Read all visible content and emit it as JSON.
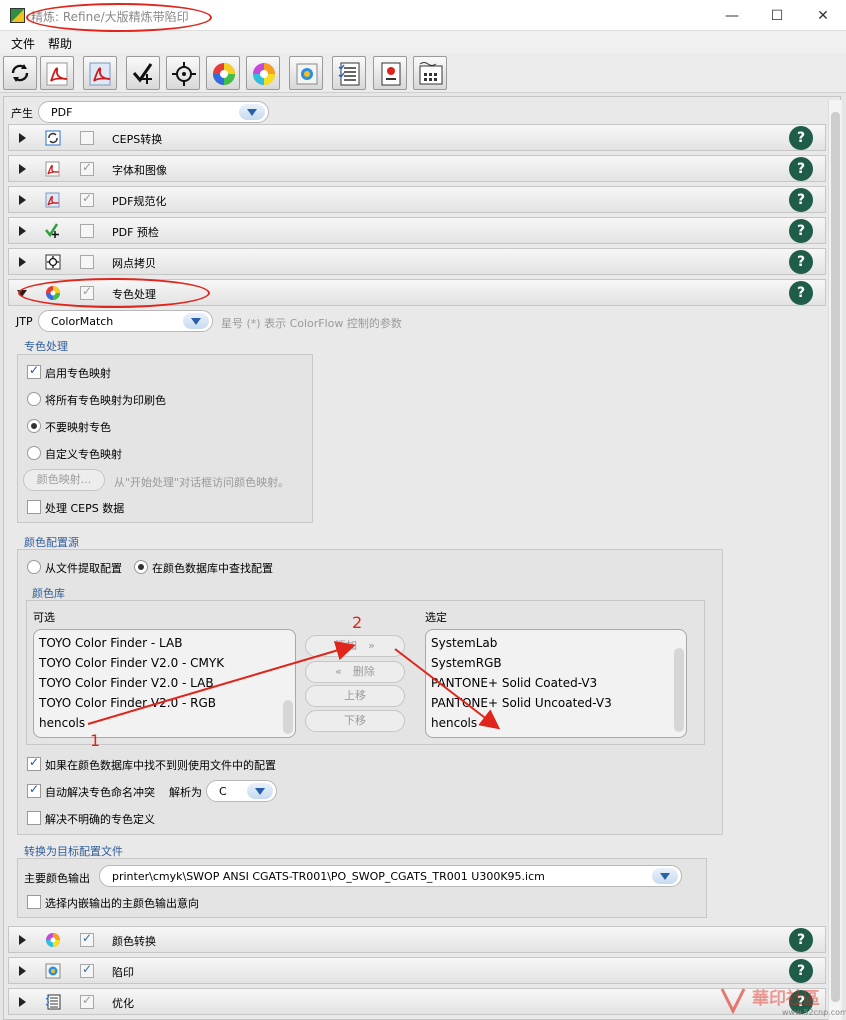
{
  "window": {
    "title": "精炼: Refine/大版精炼带陷印",
    "minimize": "—",
    "maximize": "☐",
    "close": "✕"
  },
  "menu": {
    "file": "文件",
    "help": "帮助"
  },
  "toolbar": {
    "icons": [
      "refresh-icon",
      "pdf-icon",
      "pdf-normalize-icon",
      "preflight-icon",
      "screen-icon",
      "color-wheel-icon",
      "color-convert-icon",
      "trap-icon",
      "optimize-icon",
      "proof-icon",
      "imposition-icon"
    ]
  },
  "produce": {
    "label": "产生",
    "value": "PDF"
  },
  "sections": [
    {
      "label": "CEPS转换",
      "checked": false
    },
    {
      "label": "字体和图像",
      "checked": true
    },
    {
      "label": "PDF规范化",
      "checked": true
    },
    {
      "label": "PDF 预检",
      "checked": false
    },
    {
      "label": "网点拷贝",
      "checked": false
    },
    {
      "label": "专色处理",
      "checked": true,
      "expanded": true
    }
  ],
  "spot": {
    "jtp_label": "JTP",
    "jtp_value": "ColorMatch",
    "jtp_hint": "星号 (*) 表示 ColorFlow 控制的参数",
    "group_title": "专色处理",
    "enable_mapping": "启用专色映射",
    "map_all": "将所有专色映射为印刷色",
    "no_map": "不要映射专色",
    "custom_map": "自定义专色映射",
    "color_map_button": "颜色映射...",
    "color_map_hint": "从\"开始处理\"对话框访问颜色映射。",
    "ceps_data": "处理 CEPS 数据"
  },
  "color_source": {
    "group_title": "颜色配置源",
    "from_file": "从文件提取配置",
    "from_db": "在颜色数据库中查找配置",
    "library_title": "颜色库",
    "available_label": "可选",
    "selected_label": "选定",
    "available": [
      "TOYO Color Finder - LAB",
      "TOYO Color Finder V2.0 - CMYK",
      "TOYO Color Finder V2.0 - LAB",
      "TOYO Color Finder V2.0 - RGB",
      "hencols"
    ],
    "selected": [
      "SystemLab",
      "SystemRGB",
      "PANTONE+ Solid Coated-V3",
      "PANTONE+ Solid Uncoated-V3",
      "hencols"
    ],
    "add_button": "添加　»",
    "remove_button": "«　删除",
    "up_button": "上移",
    "down_button": "下移",
    "fallback_file": "如果在颜色数据库中找不到则使用文件中的配置",
    "auto_resolve": "自动解决专色命名冲突",
    "resolve_as_label": "解析为",
    "resolve_as_value": "C",
    "undefined_spots": "解决不明确的专色定义"
  },
  "target": {
    "group_title": "转换为目标配置文件",
    "main_output_label": "主要颜色输出",
    "main_output_value": "printer\\cmyk\\SWOP ANSI CGATS-TR001\\PO_SWOP_CGATS_TR001 U300K95.icm",
    "intent": "选择内嵌输出的主颜色输出意向"
  },
  "lower_sections": [
    {
      "label": "颜色转换",
      "checked": true
    },
    {
      "label": "陷印",
      "checked": true
    },
    {
      "label": "优化",
      "checked": true
    }
  ],
  "annotations": {
    "num1": "1",
    "num2": "2"
  },
  "watermark": {
    "text": "華印社區",
    "url": "www.52cnp.com"
  },
  "colors": {
    "accent_red": "#e0261c",
    "help_green": "#1f5c4a",
    "group_title_blue": "#2f5d9a"
  }
}
